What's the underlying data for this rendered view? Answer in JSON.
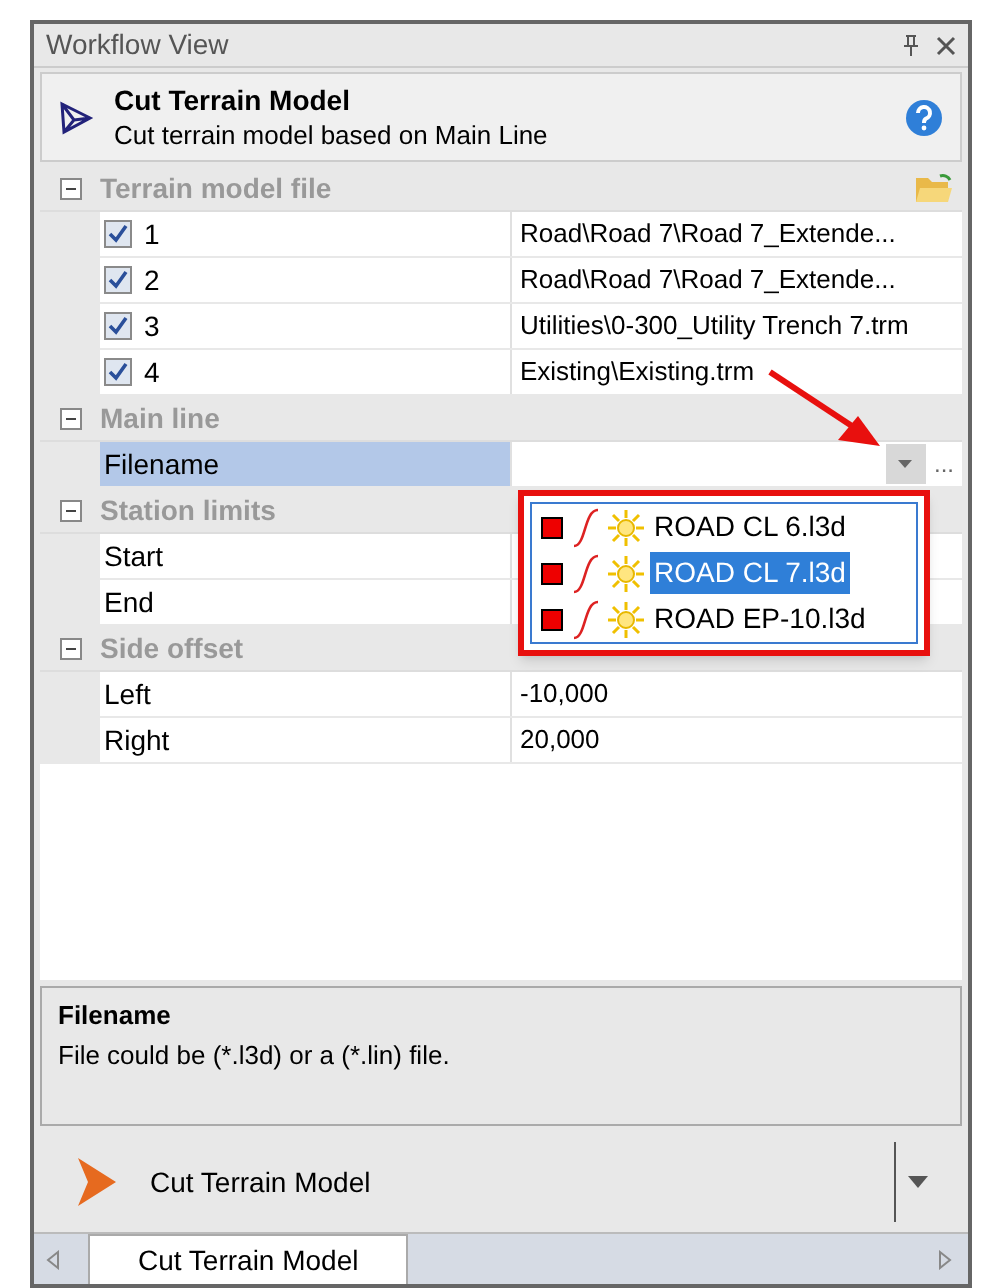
{
  "window": {
    "title": "Workflow View"
  },
  "command": {
    "title": "Cut Terrain Model",
    "description": "Cut terrain model based on Main Line"
  },
  "property_groups": [
    {
      "label": "Terrain model file",
      "expanded": true,
      "rows": [
        {
          "kind": "checkbox",
          "name": "1",
          "checked": true,
          "selected": false,
          "value": "Road\\Road 7\\Road 7_Extende..."
        },
        {
          "kind": "checkbox",
          "name": "2",
          "checked": true,
          "selected": false,
          "value": "Road\\Road 7\\Road 7_Extende..."
        },
        {
          "kind": "checkbox",
          "name": "3",
          "checked": true,
          "selected": false,
          "value": "Utilities\\0-300_Utility Trench 7.trm"
        },
        {
          "kind": "checkbox",
          "name": "4",
          "checked": true,
          "selected": false,
          "value": "Existing\\Existing.trm"
        }
      ]
    },
    {
      "label": "Main line",
      "expanded": true,
      "rows": [
        {
          "kind": "dropdown",
          "name": "Filename",
          "selected": true,
          "browse": "..."
        }
      ]
    },
    {
      "label": "Station limits",
      "expanded": true,
      "rows": [
        {
          "kind": "text",
          "name": "Start",
          "selected": false
        },
        {
          "kind": "text",
          "name": "End",
          "selected": false
        }
      ]
    },
    {
      "label": "Side offset",
      "expanded": true,
      "rows": [
        {
          "kind": "text",
          "name": "Left",
          "selected": false,
          "value": "-10,000"
        },
        {
          "kind": "text",
          "name": "Right",
          "selected": false,
          "value": "20,000"
        }
      ]
    }
  ],
  "dropdown_list": {
    "items": [
      {
        "label": "ROAD CL 6.l3d",
        "selected": false
      },
      {
        "label": "ROAD CL 7.l3d",
        "selected": true
      },
      {
        "label": "ROAD EP-10.l3d",
        "selected": false
      }
    ]
  },
  "help": {
    "title": "Filename",
    "text": "File could be (*.l3d) or a (*.lin) file."
  },
  "run_button": {
    "label": "Cut Terrain Model"
  },
  "tabs": [
    {
      "label": "Cut Terrain Model",
      "selected": true
    }
  ]
}
